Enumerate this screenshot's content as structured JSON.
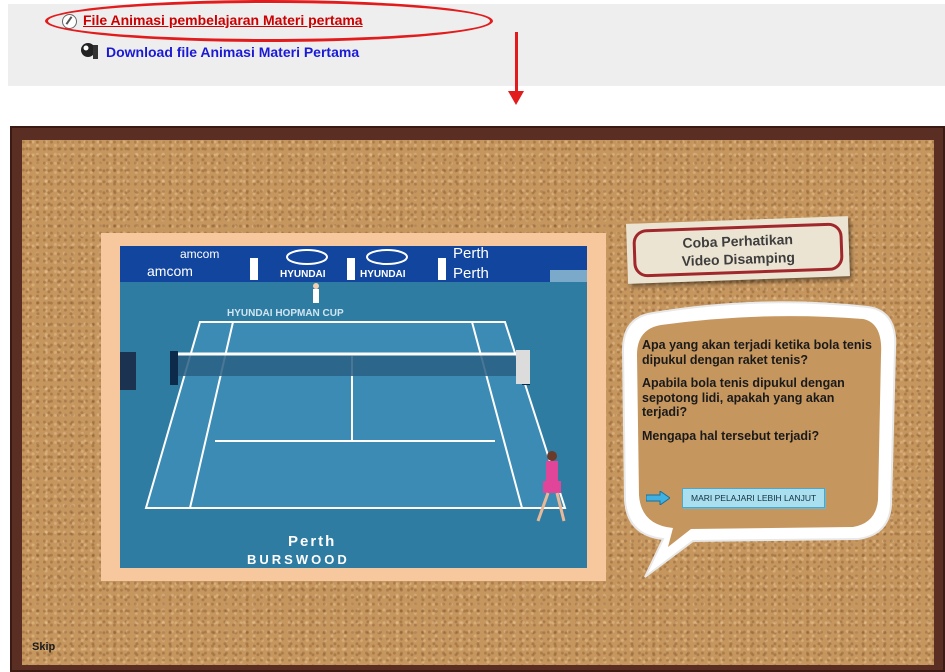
{
  "links": {
    "animation_file": "File Animasi pembelajaran Materi pertama",
    "download_file": "Download file Animasi Materi Pertama"
  },
  "sign": {
    "line1": "Coba Perhatikan",
    "line2": "Video Disamping"
  },
  "bubble": {
    "questions": [
      "Apa yang akan terjadi ketika bola tenis dipukul dengan raket tenis?",
      "Apabila bola tenis dipukul dengan sepotong lidi, apakah yang akan terjadi?",
      "Mengapa hal tersebut terjadi?"
    ],
    "cta_label": "MARI PELAJARI LEBIH LANJUT"
  },
  "video": {
    "banner_texts": [
      "amcom",
      "HYUNDAI",
      "HYUNDAI",
      "Perth",
      "Perth",
      "HYUNDAI HOPMAN CUP",
      "Perth",
      "BURSWOOD"
    ]
  },
  "skip_label": "Skip",
  "colors": {
    "link_red": "#cc0000",
    "link_blue": "#1a1ad6",
    "annotation_red": "#e21c1c",
    "cork": "#c6965f",
    "frame": "#5a2e22",
    "court_blue": "#2f7ca3",
    "cta_bg": "#a9dfee"
  }
}
